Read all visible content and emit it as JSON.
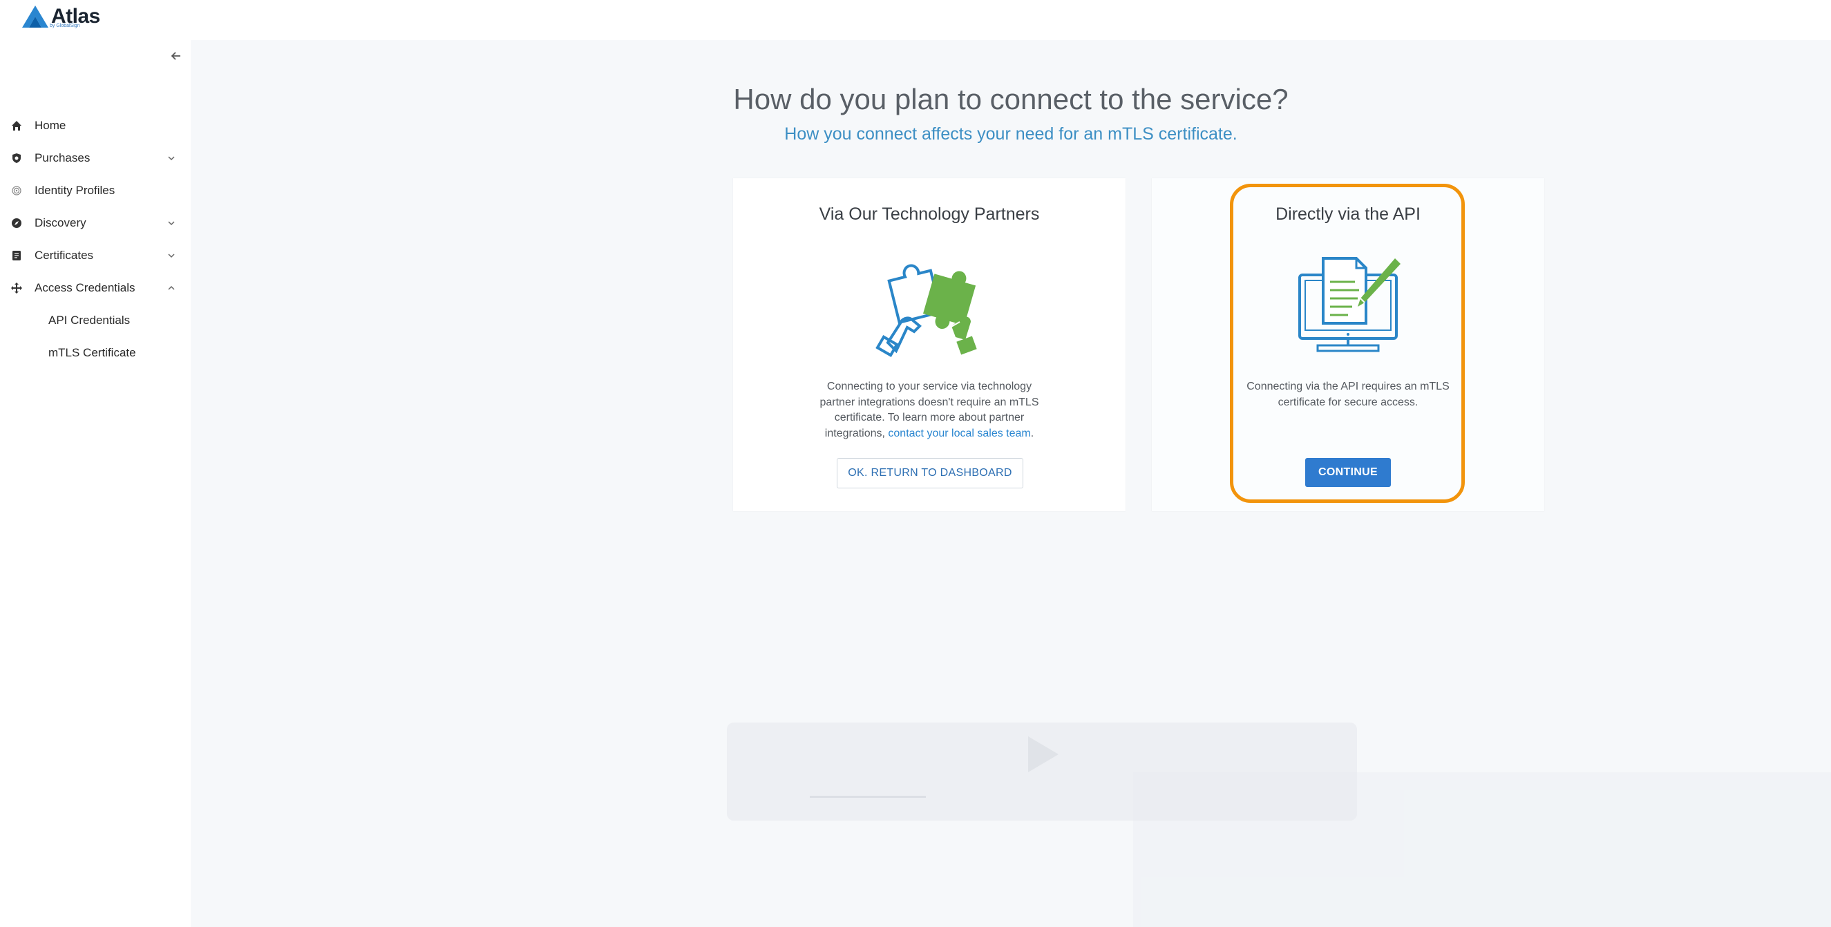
{
  "app": {
    "logo_text": "Atlas",
    "logo_sub": "by GlobalSign"
  },
  "sidebar": {
    "collapse_icon": "arrow-left-icon",
    "items": [
      {
        "label": "Home",
        "icon": "home-icon",
        "chevron": null
      },
      {
        "label": "Purchases",
        "icon": "shield-icon",
        "chevron": "down"
      },
      {
        "label": "Identity Profiles",
        "icon": "fingerprint-icon",
        "chevron": null
      },
      {
        "label": "Discovery",
        "icon": "compass-icon",
        "chevron": "down"
      },
      {
        "label": "Certificates",
        "icon": "document-icon",
        "chevron": "down"
      },
      {
        "label": "Access Credentials",
        "icon": "move-arrows-icon",
        "chevron": "up"
      }
    ],
    "subitems": [
      {
        "label": "API Credentials"
      },
      {
        "label": "mTLS Certificate"
      }
    ]
  },
  "main": {
    "heading": "How do you plan to connect to the service?",
    "subheading": "How you connect affects your need for an mTLS certificate.",
    "cards": [
      {
        "title": "Via Our Technology Partners",
        "text_before_link": "Connecting to your service via technology partner integrations doesn't require an mTLS certificate. To learn more about partner integrations, ",
        "link_text": "contact your local sales team",
        "text_after_link": ".",
        "button_label": "OK. RETURN TO DASHBOARD",
        "illustration": "puzzle-hands-illustration"
      },
      {
        "title": "Directly via the API",
        "text": "Connecting via the API requires an mTLS certificate for secure access.",
        "button_label": "CONTINUE",
        "illustration": "monitor-document-pen-illustration"
      }
    ]
  },
  "colors": {
    "accent": "#2f7bcf",
    "subheading": "#3d8fc4",
    "highlight": "#f2940c",
    "illustration_blue": "#2a86c8",
    "illustration_green": "#6bb24a"
  }
}
